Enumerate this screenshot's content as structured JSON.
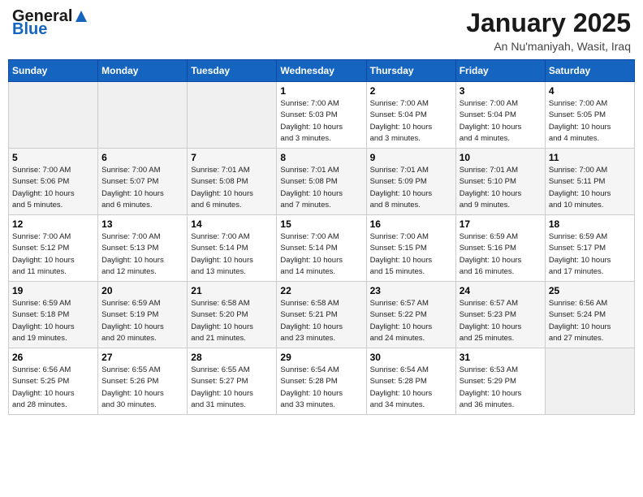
{
  "header": {
    "logo_general": "General",
    "logo_blue": "Blue",
    "title": "January 2025",
    "subtitle": "An Nu'maniyah, Wasit, Iraq"
  },
  "calendar": {
    "weekdays": [
      "Sunday",
      "Monday",
      "Tuesday",
      "Wednesday",
      "Thursday",
      "Friday",
      "Saturday"
    ],
    "rows": [
      [
        {
          "day": "",
          "detail": ""
        },
        {
          "day": "",
          "detail": ""
        },
        {
          "day": "",
          "detail": ""
        },
        {
          "day": "1",
          "detail": "Sunrise: 7:00 AM\nSunset: 5:03 PM\nDaylight: 10 hours\nand 3 minutes."
        },
        {
          "day": "2",
          "detail": "Sunrise: 7:00 AM\nSunset: 5:04 PM\nDaylight: 10 hours\nand 3 minutes."
        },
        {
          "day": "3",
          "detail": "Sunrise: 7:00 AM\nSunset: 5:04 PM\nDaylight: 10 hours\nand 4 minutes."
        },
        {
          "day": "4",
          "detail": "Sunrise: 7:00 AM\nSunset: 5:05 PM\nDaylight: 10 hours\nand 4 minutes."
        }
      ],
      [
        {
          "day": "5",
          "detail": "Sunrise: 7:00 AM\nSunset: 5:06 PM\nDaylight: 10 hours\nand 5 minutes."
        },
        {
          "day": "6",
          "detail": "Sunrise: 7:00 AM\nSunset: 5:07 PM\nDaylight: 10 hours\nand 6 minutes."
        },
        {
          "day": "7",
          "detail": "Sunrise: 7:01 AM\nSunset: 5:08 PM\nDaylight: 10 hours\nand 6 minutes."
        },
        {
          "day": "8",
          "detail": "Sunrise: 7:01 AM\nSunset: 5:08 PM\nDaylight: 10 hours\nand 7 minutes."
        },
        {
          "day": "9",
          "detail": "Sunrise: 7:01 AM\nSunset: 5:09 PM\nDaylight: 10 hours\nand 8 minutes."
        },
        {
          "day": "10",
          "detail": "Sunrise: 7:01 AM\nSunset: 5:10 PM\nDaylight: 10 hours\nand 9 minutes."
        },
        {
          "day": "11",
          "detail": "Sunrise: 7:00 AM\nSunset: 5:11 PM\nDaylight: 10 hours\nand 10 minutes."
        }
      ],
      [
        {
          "day": "12",
          "detail": "Sunrise: 7:00 AM\nSunset: 5:12 PM\nDaylight: 10 hours\nand 11 minutes."
        },
        {
          "day": "13",
          "detail": "Sunrise: 7:00 AM\nSunset: 5:13 PM\nDaylight: 10 hours\nand 12 minutes."
        },
        {
          "day": "14",
          "detail": "Sunrise: 7:00 AM\nSunset: 5:14 PM\nDaylight: 10 hours\nand 13 minutes."
        },
        {
          "day": "15",
          "detail": "Sunrise: 7:00 AM\nSunset: 5:14 PM\nDaylight: 10 hours\nand 14 minutes."
        },
        {
          "day": "16",
          "detail": "Sunrise: 7:00 AM\nSunset: 5:15 PM\nDaylight: 10 hours\nand 15 minutes."
        },
        {
          "day": "17",
          "detail": "Sunrise: 6:59 AM\nSunset: 5:16 PM\nDaylight: 10 hours\nand 16 minutes."
        },
        {
          "day": "18",
          "detail": "Sunrise: 6:59 AM\nSunset: 5:17 PM\nDaylight: 10 hours\nand 17 minutes."
        }
      ],
      [
        {
          "day": "19",
          "detail": "Sunrise: 6:59 AM\nSunset: 5:18 PM\nDaylight: 10 hours\nand 19 minutes."
        },
        {
          "day": "20",
          "detail": "Sunrise: 6:59 AM\nSunset: 5:19 PM\nDaylight: 10 hours\nand 20 minutes."
        },
        {
          "day": "21",
          "detail": "Sunrise: 6:58 AM\nSunset: 5:20 PM\nDaylight: 10 hours\nand 21 minutes."
        },
        {
          "day": "22",
          "detail": "Sunrise: 6:58 AM\nSunset: 5:21 PM\nDaylight: 10 hours\nand 23 minutes."
        },
        {
          "day": "23",
          "detail": "Sunrise: 6:57 AM\nSunset: 5:22 PM\nDaylight: 10 hours\nand 24 minutes."
        },
        {
          "day": "24",
          "detail": "Sunrise: 6:57 AM\nSunset: 5:23 PM\nDaylight: 10 hours\nand 25 minutes."
        },
        {
          "day": "25",
          "detail": "Sunrise: 6:56 AM\nSunset: 5:24 PM\nDaylight: 10 hours\nand 27 minutes."
        }
      ],
      [
        {
          "day": "26",
          "detail": "Sunrise: 6:56 AM\nSunset: 5:25 PM\nDaylight: 10 hours\nand 28 minutes."
        },
        {
          "day": "27",
          "detail": "Sunrise: 6:55 AM\nSunset: 5:26 PM\nDaylight: 10 hours\nand 30 minutes."
        },
        {
          "day": "28",
          "detail": "Sunrise: 6:55 AM\nSunset: 5:27 PM\nDaylight: 10 hours\nand 31 minutes."
        },
        {
          "day": "29",
          "detail": "Sunrise: 6:54 AM\nSunset: 5:28 PM\nDaylight: 10 hours\nand 33 minutes."
        },
        {
          "day": "30",
          "detail": "Sunrise: 6:54 AM\nSunset: 5:28 PM\nDaylight: 10 hours\nand 34 minutes."
        },
        {
          "day": "31",
          "detail": "Sunrise: 6:53 AM\nSunset: 5:29 PM\nDaylight: 10 hours\nand 36 minutes."
        },
        {
          "day": "",
          "detail": ""
        }
      ]
    ]
  }
}
